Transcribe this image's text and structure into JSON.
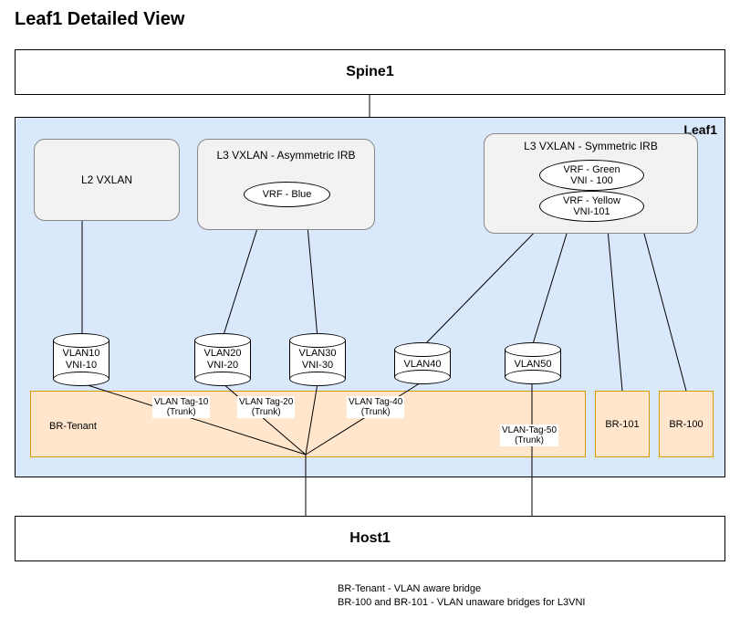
{
  "title": "Leaf1 Detailed View",
  "spine": {
    "label": "Spine1"
  },
  "leaf": {
    "label": "Leaf1"
  },
  "host": {
    "label": "Host1"
  },
  "l2_box": {
    "label": "L2 VXLAN"
  },
  "l3_asym_box": {
    "label": "L3 VXLAN - Asymmetric IRB",
    "vrf": "VRF -  Blue"
  },
  "l3_sym_box": {
    "label": "L3 VXLAN - Symmetric IRB",
    "vrf_green": "VRF - Green\nVNI - 100",
    "vrf_yellow": "VRF -  Yellow\nVNI-101"
  },
  "cylinders": {
    "v10": "VLAN10\nVNI-10",
    "v20": "VLAN20\nVNI-20",
    "v30": "VLAN30\nVNI-30",
    "v40": "VLAN40",
    "v50": "VLAN50"
  },
  "bridges": {
    "tenant": "BR-Tenant",
    "b101": "BR-101",
    "b100": "BR-100"
  },
  "tags": {
    "t10": "VLAN Tag-10\n(Trunk)",
    "t20": "VLAN Tag-20\n(Trunk)",
    "t40": "VLAN Tag-40\n(Trunk)",
    "t50": "VLAN-Tag-50\n(Trunk)"
  },
  "footnotes": {
    "line1": "BR-Tenant - VLAN aware bridge",
    "line2": "BR-100 and BR-101 - VLAN unaware bridges for L3VNI"
  }
}
